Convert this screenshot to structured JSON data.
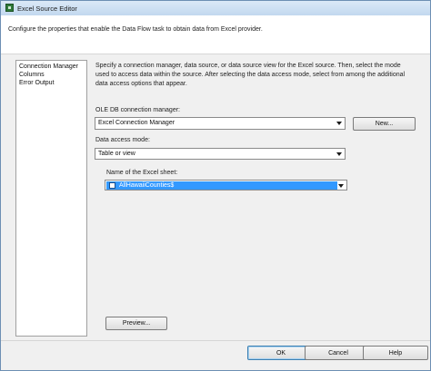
{
  "window": {
    "title": "Excel Source Editor"
  },
  "header": {
    "description": "Configure the properties that enable the Data Flow task to obtain data from Excel provider."
  },
  "nav": {
    "items": [
      {
        "label": "Connection Manager"
      },
      {
        "label": "Columns"
      },
      {
        "label": "Error Output"
      }
    ]
  },
  "main": {
    "description": "Specify a connection manager, data source, or data source view for the Excel source. Then, select the mode used to access data within the source. After selecting the data access mode, select from among the additional data access options that appear.",
    "connection_label": "OLE DB connection manager:",
    "connection_value": "Excel Connection Manager",
    "new_button": "New...",
    "access_mode_label": "Data access mode:",
    "access_mode_value": "Table or view",
    "sheet_label": "Name of the Excel sheet:",
    "sheet_value": "AllHawaiiCounties$",
    "preview_button": "Preview..."
  },
  "footer": {
    "ok": "OK",
    "cancel": "Cancel",
    "help": "Help"
  },
  "icons": {
    "app": "excel-source-icon",
    "sheet": "sheet-table-icon",
    "dropdown": "chevron-down-icon"
  },
  "colors": {
    "selection": "#3399ff",
    "title_bar": "#c2d8ef"
  }
}
